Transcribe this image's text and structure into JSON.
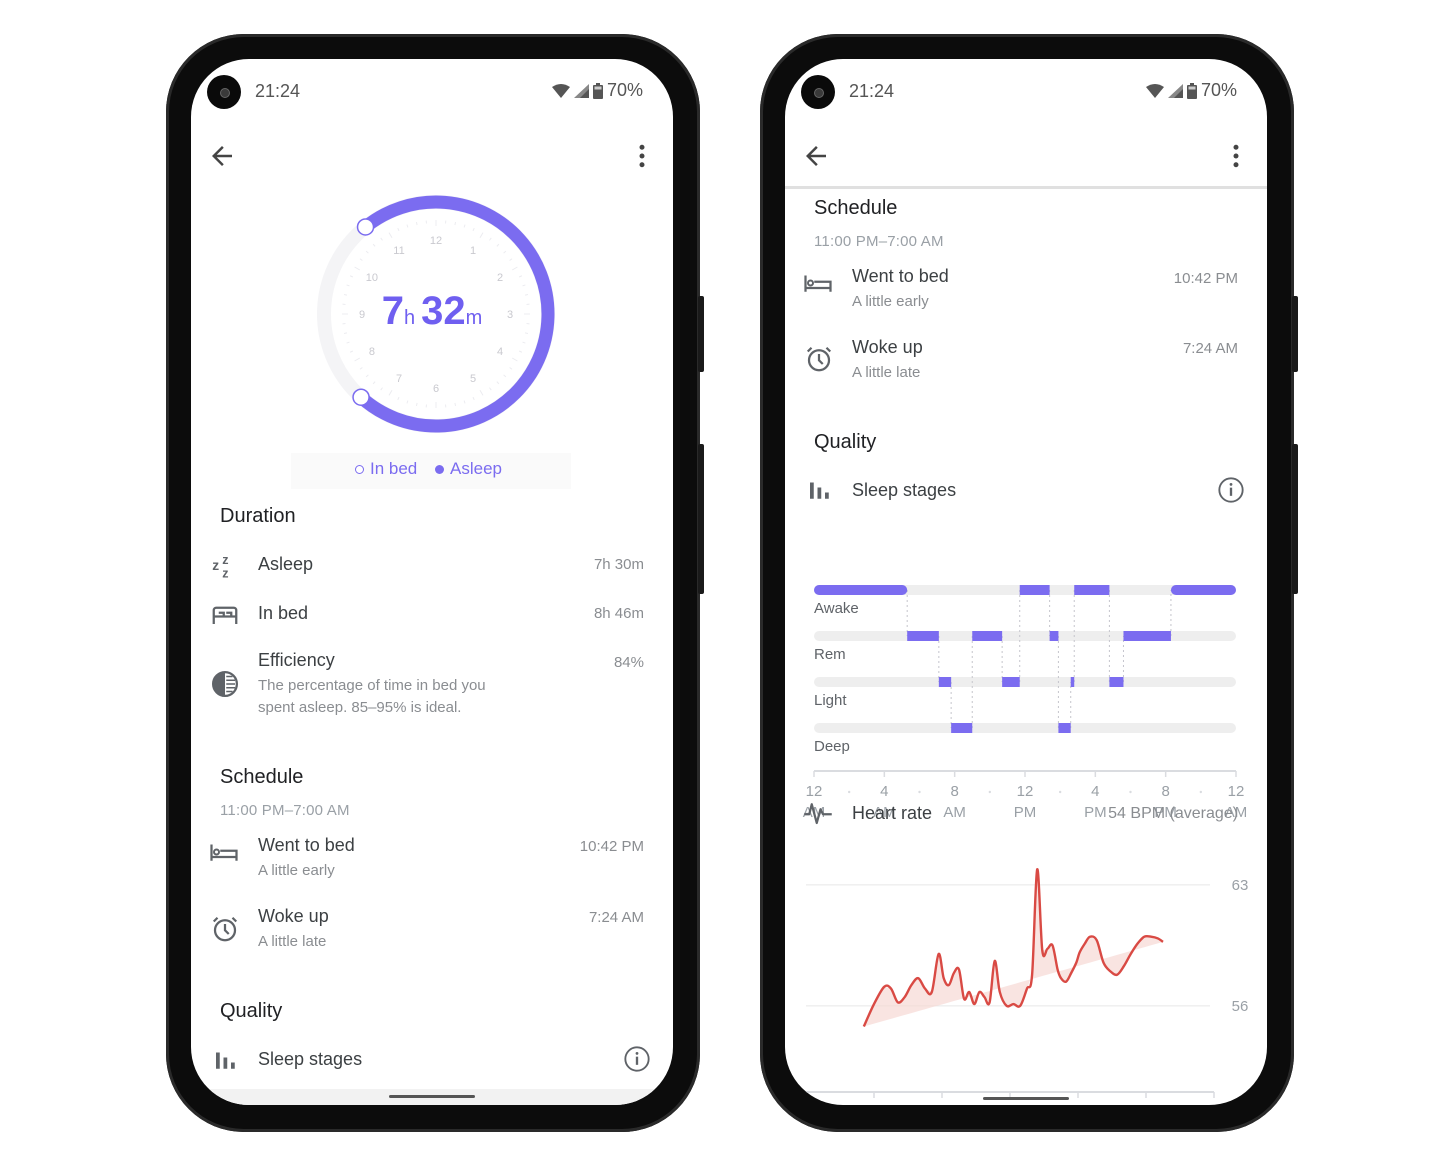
{
  "colors": {
    "accent": "#7b6cf0",
    "heart_line": "#d94a44",
    "heart_fill": "#f6d8d4",
    "track": "#eeeeee",
    "text_primary": "#202124",
    "text_secondary": "#8a8d91"
  },
  "status_bar": {
    "time": "21:24",
    "battery": "70%",
    "icons": [
      "wifi-icon",
      "signal-icon",
      "battery-icon"
    ]
  },
  "app_bar": {
    "back_icon": "arrow-back-icon",
    "menu_icon": "more-vert-icon"
  },
  "left_screen": {
    "dial": {
      "hours": "7",
      "hours_unit": "h",
      "minutes": "32",
      "minutes_unit": "m",
      "clock_numbers": [
        "12",
        "1",
        "2",
        "3",
        "4",
        "5",
        "6",
        "7",
        "8",
        "9",
        "10",
        "11"
      ],
      "in_bed_start": "10:42 PM",
      "in_bed_end": "7:24 AM"
    },
    "legend": {
      "in_bed": "In bed",
      "asleep": "Asleep"
    },
    "duration": {
      "title": "Duration",
      "items": [
        {
          "icon": "zzz-icon",
          "label": "Asleep",
          "value": "7h 30m"
        },
        {
          "icon": "bed-icon",
          "label": "In bed",
          "value": "8h 46m"
        },
        {
          "icon": "efficiency-icon",
          "label": "Efficiency",
          "value": "84%",
          "description_line1": "The percentage of time in bed you",
          "description_line2": "spent asleep. 85–95% is ideal."
        }
      ]
    },
    "schedule": {
      "title": "Schedule",
      "range": "11:00 PM–7:00 AM",
      "items": [
        {
          "icon": "hotel-bed-icon",
          "label": "Went to bed",
          "sub": "A little early",
          "value": "10:42 PM"
        },
        {
          "icon": "alarm-clock-icon",
          "label": "Woke up",
          "sub": "A little late",
          "value": "7:24 AM"
        }
      ]
    },
    "quality": {
      "title": "Quality",
      "sleep_stages_label": "Sleep stages",
      "info_icon": "info-icon"
    }
  },
  "right_screen": {
    "schedule": {
      "title": "Schedule",
      "range": "11:00 PM–7:00 AM",
      "items": [
        {
          "icon": "hotel-bed-icon",
          "label": "Went to bed",
          "sub": "A little early",
          "value": "10:42 PM"
        },
        {
          "icon": "alarm-clock-icon",
          "label": "Woke up",
          "sub": "A little late",
          "value": "7:24 AM"
        }
      ]
    },
    "quality": {
      "title": "Quality",
      "sleep_stages_label": "Sleep stages",
      "heart_rate_label": "Heart rate",
      "heart_rate_value": "54 BPM (average)"
    },
    "x_axis": [
      {
        "top": "12",
        "bottom": "AM"
      },
      {
        "top": "4",
        "bottom": "AM"
      },
      {
        "top": "8",
        "bottom": "AM"
      },
      {
        "top": "12",
        "bottom": "PM"
      },
      {
        "top": "4",
        "bottom": "PM"
      },
      {
        "top": "8",
        "bottom": "PM"
      },
      {
        "top": "12",
        "bottom": "AM"
      }
    ]
  },
  "chart_data": [
    {
      "type": "bar",
      "title": "Sleep stages",
      "stages": [
        "Awake",
        "Rem",
        "Light",
        "Deep"
      ],
      "x_range_hours": [
        0,
        24
      ],
      "x_ticks": [
        "12 AM",
        "4 AM",
        "8 AM",
        "12 PM",
        "4 PM",
        "8 PM",
        "12 AM"
      ],
      "segments": [
        {
          "stage": "Awake",
          "start": 0.0,
          "end": 5.3
        },
        {
          "stage": "Rem",
          "start": 5.3,
          "end": 7.1
        },
        {
          "stage": "Light",
          "start": 7.1,
          "end": 7.8
        },
        {
          "stage": "Deep",
          "start": 7.8,
          "end": 9.0
        },
        {
          "stage": "Rem",
          "start": 9.0,
          "end": 10.7
        },
        {
          "stage": "Light",
          "start": 10.7,
          "end": 11.7
        },
        {
          "stage": "Awake",
          "start": 11.7,
          "end": 13.4
        },
        {
          "stage": "Rem",
          "start": 13.4,
          "end": 13.9
        },
        {
          "stage": "Deep",
          "start": 13.9,
          "end": 14.6
        },
        {
          "stage": "Light",
          "start": 14.6,
          "end": 14.8
        },
        {
          "stage": "Awake",
          "start": 14.8,
          "end": 16.8
        },
        {
          "stage": "Light",
          "start": 16.8,
          "end": 17.6
        },
        {
          "stage": "Rem",
          "start": 17.6,
          "end": 20.3
        },
        {
          "stage": "Awake",
          "start": 20.3,
          "end": 24.0
        }
      ]
    },
    {
      "type": "line",
      "title": "Heart rate",
      "subtitle": "54 BPM (average)",
      "x_ticks": [
        "12 AM",
        "4 AM",
        "8 AM",
        "12 PM",
        "4 PM",
        "8 PM",
        "12 AM"
      ],
      "x_range_hours": [
        0,
        24
      ],
      "y_gridlines": [
        56,
        63
      ],
      "ylim": [
        53.5,
        64.5
      ],
      "x": [
        3.4,
        4.0,
        4.6,
        5.0,
        5.4,
        5.8,
        6.2,
        6.6,
        7.0,
        7.4,
        7.8,
        8.1,
        8.4,
        8.7,
        9.0,
        9.3,
        9.6,
        9.9,
        10.2,
        10.5,
        10.8,
        11.1,
        11.4,
        11.8,
        12.2,
        12.6,
        13.0,
        13.3,
        13.6,
        13.9,
        14.2,
        14.5,
        14.8,
        15.0,
        15.3,
        15.6,
        15.9,
        16.1,
        16.4,
        16.7,
        17.1,
        17.5,
        17.9,
        18.3,
        18.7,
        19.1,
        19.5,
        19.9,
        20.3,
        20.7,
        21.0
      ],
      "y": [
        54.8,
        56.1,
        57.1,
        57.0,
        56.2,
        56.5,
        57.2,
        57.6,
        57.0,
        56.8,
        59.0,
        57.6,
        57.2,
        57.9,
        58.1,
        56.4,
        56.8,
        56.1,
        56.8,
        56.5,
        56.2,
        58.6,
        56.8,
        56.0,
        56.1,
        56.0,
        57.0,
        57.8,
        63.9,
        59.2,
        59.3,
        59.5,
        58.1,
        57.6,
        57.4,
        57.9,
        58.5,
        59.1,
        59.6,
        60.0,
        59.8,
        58.5,
        58.0,
        57.8,
        58.3,
        59.0,
        59.6,
        60.0,
        60.0,
        59.9,
        59.7
      ],
      "trend_start": 54.8,
      "trend_end": 59.7
    }
  ]
}
